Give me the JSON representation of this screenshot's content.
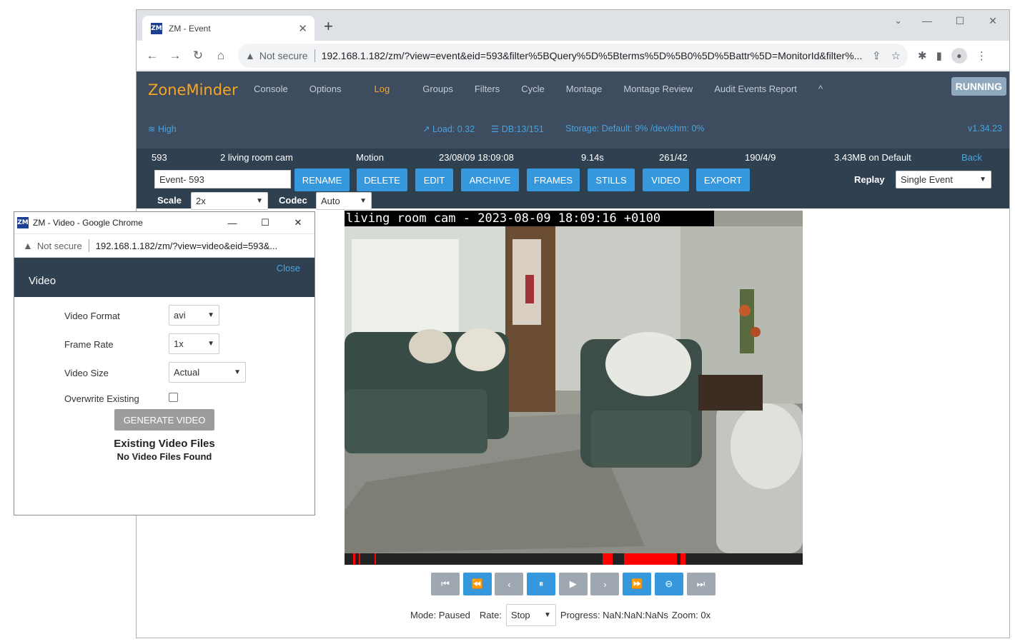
{
  "browser": {
    "tab_title": "ZM - Event",
    "new_tab": "+",
    "not_secure": "Not secure",
    "url": "192.168.1.182/zm/?view=event&eid=593&filter%5BQuery%5D%5Bterms%5D%5B0%5D%5Battr%5D=MonitorId&filter%..."
  },
  "zm": {
    "brand": "ZoneMinder",
    "menu": [
      "Console",
      "Options",
      "Log",
      "Groups",
      "Filters",
      "Cycle",
      "Montage",
      "Montage Review",
      "Audit Events Report"
    ],
    "active_menu": "Log",
    "collapse": "^",
    "state": "RUNNING",
    "signal": "High",
    "load": "Load: 0.32",
    "db": "DB:13/151",
    "storage": "Storage: Default: 9% /dev/shm: 0%",
    "version": "v1.34.23"
  },
  "event": {
    "id": "593",
    "monitor": "2 living room cam",
    "cause": "Motion",
    "time": "23/08/09 18:09:08",
    "duration": "9.14s",
    "frames": "261/42",
    "scores": "190/4/9",
    "size": "3.43MB on Default",
    "back": "Back",
    "name_value": "Event- 593",
    "buttons": [
      "RENAME",
      "DELETE",
      "EDIT",
      "ARCHIVE",
      "FRAMES",
      "STILLS",
      "VIDEO",
      "EXPORT"
    ],
    "replay_label": "Replay",
    "replay_value": "Single Event",
    "scale_label": "Scale",
    "scale_value": "2x",
    "codec_label": "Codec",
    "codec_value": "Auto"
  },
  "video": {
    "timestamp": "living room cam - 2023-08-09 18:09:16 +0100"
  },
  "player": {
    "mode": "Mode: Paused",
    "rate_label": "Rate:",
    "rate_value": "Stop",
    "progress": "Progress: NaN:NaN:NaNs",
    "zoom": "Zoom: 0x"
  },
  "popup": {
    "window_title": "ZM - Video - Google Chrome",
    "not_secure": "Not secure",
    "url": "192.168.1.182/zm/?view=video&eid=593&...",
    "close": "Close",
    "title": "Video",
    "format_label": "Video Format",
    "format_value": "avi",
    "rate_label": "Frame Rate",
    "rate_value": "1x",
    "size_label": "Video Size",
    "size_value": "Actual",
    "overwrite_label": "Overwrite Existing",
    "generate": "GENERATE VIDEO",
    "existing_title": "Existing Video Files",
    "existing_none": "No Video Files Found"
  },
  "colors": {
    "brand": "#f5a623",
    "nav_bg": "#3d4c5e",
    "event_bg": "#2f4050",
    "button": "#3598dc",
    "link": "#4aa3df"
  }
}
